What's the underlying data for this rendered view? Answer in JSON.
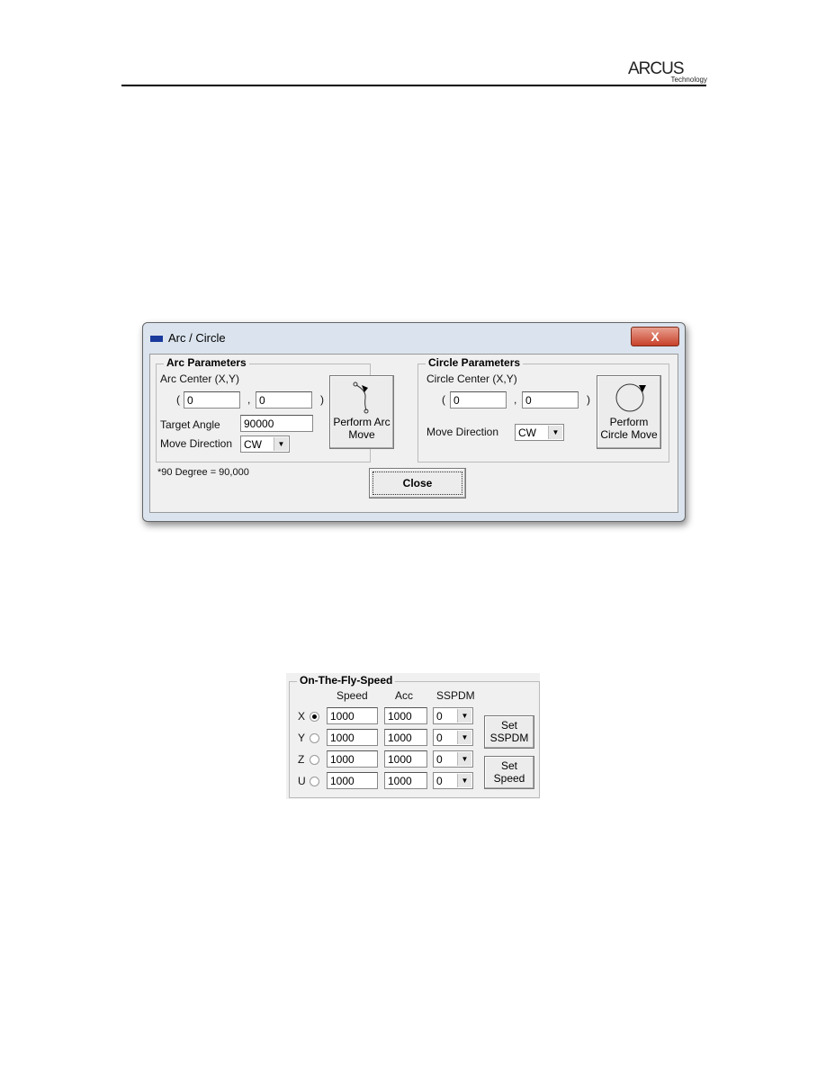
{
  "header": {
    "logo": "ARCUS",
    "logo_sub": "Technology"
  },
  "dialog": {
    "title": "Arc / Circle",
    "close_x": "X",
    "arc": {
      "group": "Arc Parameters",
      "center_label": "Arc Center (X,Y)",
      "open": "(",
      "comma": ",",
      "close": ")",
      "x": "0",
      "y": "0",
      "angle_label": "Target Angle",
      "angle": "90000",
      "dir_label": "Move Direction",
      "dir": "CW",
      "button": "Perform Arc Move"
    },
    "circle": {
      "group": "Circle Parameters",
      "center_label": "Circle Center (X,Y)",
      "open": "(",
      "comma": ",",
      "close": ")",
      "x": "0",
      "y": "0",
      "dir_label": "Move Direction",
      "dir": "CW",
      "button": "Perform Circle Move"
    },
    "note": "*90 Degree = 90,000",
    "close_button": "Close"
  },
  "otf": {
    "group": "On-The-Fly-Speed",
    "headers": [
      "Speed",
      "Acc",
      "SSPDM"
    ],
    "rows": [
      {
        "axis": "X",
        "selected": true,
        "speed": "1000",
        "acc": "1000",
        "sspdm": "0"
      },
      {
        "axis": "Y",
        "selected": false,
        "speed": "1000",
        "acc": "1000",
        "sspdm": "0"
      },
      {
        "axis": "Z",
        "selected": false,
        "speed": "1000",
        "acc": "1000",
        "sspdm": "0"
      },
      {
        "axis": "U",
        "selected": false,
        "speed": "1000",
        "acc": "1000",
        "sspdm": "0"
      }
    ],
    "set_sspdm": "Set SSPDM",
    "set_speed": "Set Speed"
  }
}
